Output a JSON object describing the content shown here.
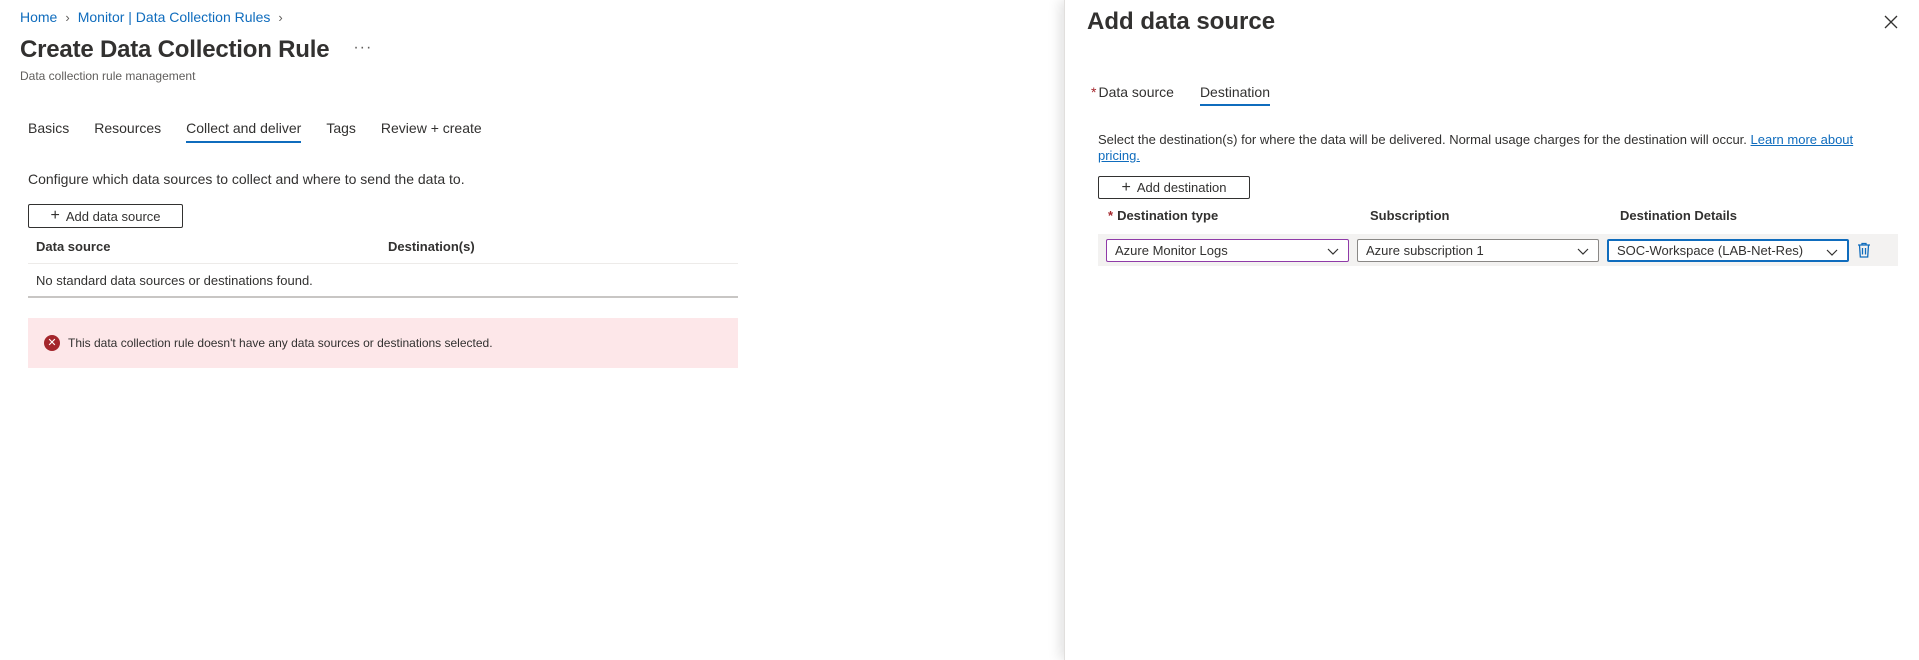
{
  "breadcrumb": {
    "home": "Home",
    "monitor": "Monitor | Data Collection Rules"
  },
  "page": {
    "title": "Create Data Collection Rule",
    "more": "···",
    "subtitle": "Data collection rule management"
  },
  "tabs": [
    {
      "label": "Basics",
      "active": false
    },
    {
      "label": "Resources",
      "active": false
    },
    {
      "label": "Collect and deliver",
      "active": true
    },
    {
      "label": "Tags",
      "active": false
    },
    {
      "label": "Review + create",
      "active": false
    }
  ],
  "collect": {
    "description": "Configure which data sources to collect and where to send the data to.",
    "add_button": "Add data source",
    "columns": [
      "Data source",
      "Destination(s)"
    ],
    "empty_text": "No standard data sources or destinations found.",
    "error_text": "This data collection rule doesn't have any data sources or destinations selected."
  },
  "panel": {
    "title": "Add data source",
    "tabs": [
      {
        "label": "Data source",
        "required": true,
        "active": false
      },
      {
        "label": "Destination",
        "required": false,
        "active": true
      }
    ],
    "description": "Select the destination(s) for where the data will be delivered. Normal usage charges for the destination will occur.",
    "learn_more": "Learn more about pricing.",
    "add_destination": "Add destination",
    "columns": {
      "destination_type": "Destination type",
      "subscription": "Subscription",
      "destination_details": "Destination Details"
    },
    "row": {
      "destination_type": "Azure Monitor Logs",
      "subscription": "Azure subscription 1",
      "destination_details": "SOC-Workspace (LAB-Net-Res)"
    }
  },
  "colors": {
    "accent": "#0f6cbd",
    "error": "#a4262c",
    "error_bg": "#fde7e9",
    "required": "#a4262c"
  }
}
